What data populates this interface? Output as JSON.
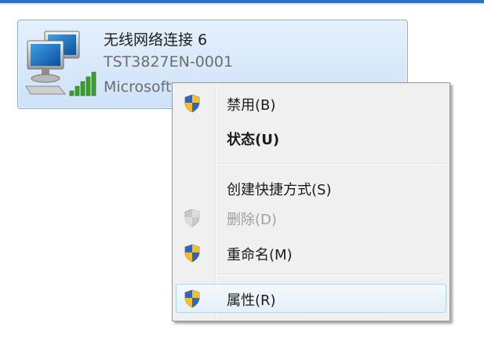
{
  "connection": {
    "name": "无线网络连接 6",
    "device": "TST3827EN-0001",
    "adapter": "Microsoft",
    "icon": "wireless-network-computer-icon"
  },
  "context_menu": {
    "items": [
      {
        "label": "禁用(B)",
        "icon": "uac-shield-icon",
        "style": "normal"
      },
      {
        "label": "状态(U)",
        "icon": "none",
        "style": "bold-default"
      },
      {
        "label": "创建快捷方式(S)",
        "icon": "none",
        "style": "normal"
      },
      {
        "label": "删除(D)",
        "icon": "uac-shield-icon",
        "style": "disabled"
      },
      {
        "label": "重命名(M)",
        "icon": "uac-shield-icon",
        "style": "normal"
      },
      {
        "label": "属性(R)",
        "icon": "uac-shield-icon",
        "style": "highlighted"
      }
    ]
  },
  "colors": {
    "tile_border": "#84acdd",
    "tile_fill": "#d8e8fa",
    "menu_background": "#f0f0f0",
    "hover_border": "#a8d8eb",
    "disabled_text": "#a0a0a0",
    "shield_blue": "#2f63c4",
    "shield_yellow": "#f4c21a"
  }
}
